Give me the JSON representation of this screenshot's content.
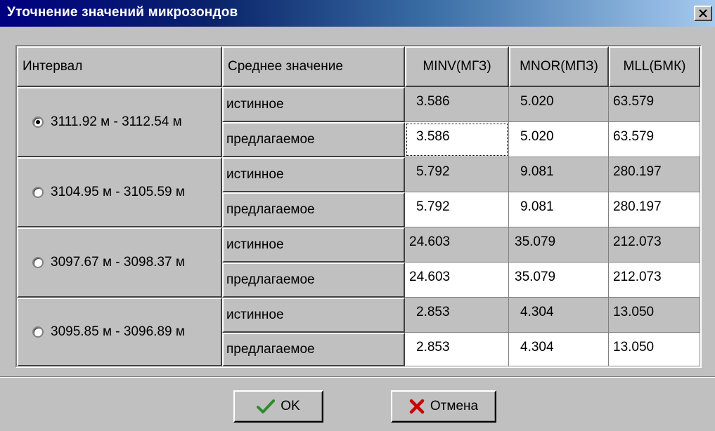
{
  "window": {
    "title": "Уточнение значений микрозондов"
  },
  "table": {
    "headers": {
      "interval": "Интервал",
      "mean": "Среднее значение",
      "minv": "MINV(МГЗ)",
      "mnor": "MNOR(МПЗ)",
      "mll": "MLL(БМК)"
    },
    "rows": [
      {
        "interval": "3111.92 м - 3112.54 м",
        "selected": true,
        "true_label": "истинное",
        "proposed_label": "предлагаемое",
        "true_values": [
          "3.586",
          "5.020",
          "63.579"
        ],
        "proposed_values": [
          "3.586",
          "5.020",
          "63.579"
        ]
      },
      {
        "interval": "3104.95 м - 3105.59 м",
        "selected": false,
        "true_label": "истинное",
        "proposed_label": "предлагаемое",
        "true_values": [
          "5.792",
          "9.081",
          "280.197"
        ],
        "proposed_values": [
          "5.792",
          "9.081",
          "280.197"
        ]
      },
      {
        "interval": "3097.67 м - 3098.37 м",
        "selected": false,
        "true_label": "истинное",
        "proposed_label": "предлагаемое",
        "true_values": [
          "24.603",
          "35.079",
          "212.073"
        ],
        "proposed_values": [
          "24.603",
          "35.079",
          "212.073"
        ]
      },
      {
        "interval": "3095.85 м - 3096.89 м",
        "selected": false,
        "true_label": "истинное",
        "proposed_label": "предлагаемое",
        "true_values": [
          "2.853",
          "4.304",
          "13.050"
        ],
        "proposed_values": [
          "2.853",
          "4.304",
          "13.050"
        ]
      }
    ]
  },
  "buttons": {
    "ok": "OK",
    "cancel": "Отмена"
  },
  "icons": {
    "close": "close-icon",
    "ok": "checkmark-icon",
    "cancel": "cross-icon"
  },
  "colors": {
    "title_bar": "#000080",
    "checkmark": "#2e8b2e",
    "cross": "#cc0000"
  }
}
